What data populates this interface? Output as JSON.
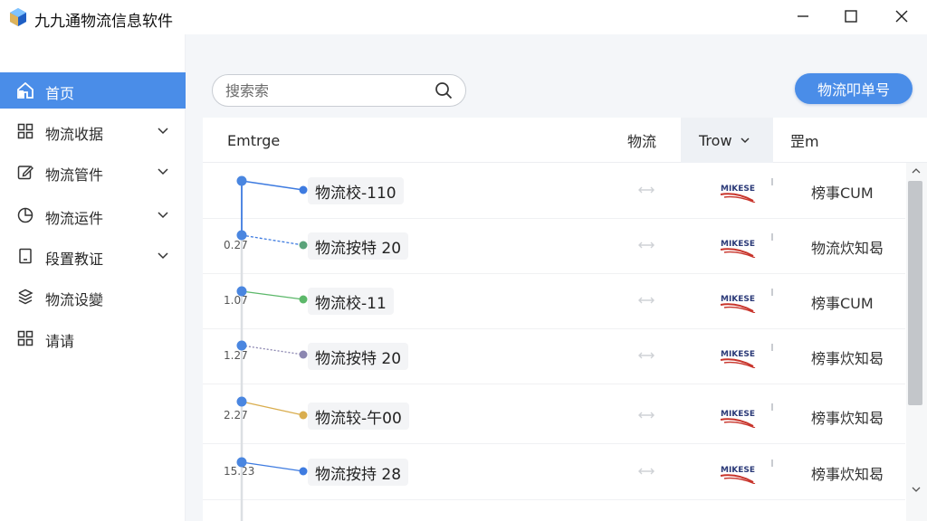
{
  "window": {
    "title": "九九通物流信息软件"
  },
  "sidebar": {
    "items": [
      {
        "label": "首页",
        "icon": "home-icon",
        "active": true,
        "chevron": false
      },
      {
        "label": "物流收据",
        "icon": "grid-icon",
        "active": false,
        "chevron": true
      },
      {
        "label": "物流管件",
        "icon": "edit-icon",
        "active": false,
        "chevron": true
      },
      {
        "label": "物流运件",
        "icon": "pie-chart-icon",
        "active": false,
        "chevron": true
      },
      {
        "label": "段置教证",
        "icon": "document-icon",
        "active": false,
        "chevron": true
      },
      {
        "label": "物流设變",
        "icon": "layers-icon",
        "active": false,
        "chevron": false
      },
      {
        "label": "请请",
        "icon": "grid-icon",
        "active": false,
        "chevron": false
      }
    ]
  },
  "toolbar": {
    "search_placeholder": "搜索索",
    "primary_button": "物流叩单号"
  },
  "table": {
    "columns": [
      {
        "label": "Emtrge"
      },
      {
        "label": "物流"
      },
      {
        "label": "Trow",
        "sorted": true,
        "chevron": "chevron-down-icon"
      },
      {
        "label": "罡m"
      }
    ],
    "rows": [
      {
        "time": "",
        "name": "物流校-110",
        "dot_color": "#3e7be0",
        "brand": "MIKESE",
        "status": "榜事CUM"
      },
      {
        "time": "0.27",
        "name": "物流按特 20",
        "dot_color": "#5aa37a",
        "brand": "MIKESE",
        "status": "物流炊知曷"
      },
      {
        "time": "1.07",
        "name": "物流校-11",
        "dot_color": "#5cb86a",
        "brand": "MIKESE",
        "status": "榜事CUM"
      },
      {
        "time": "1.27",
        "name": "物流按特 20",
        "dot_color": "#8b86b0",
        "brand": "MIKESE",
        "status": "榜事炊知曷"
      },
      {
        "time": "2.27",
        "name": "物流较-午00",
        "dot_color": "#d9ad4e",
        "brand": "MIKESE",
        "status": "榜事炊知曷"
      },
      {
        "time": "15.23",
        "name": "物流按持 28",
        "dot_color": "#3e7be0",
        "brand": "MIKESE",
        "status": "榜事炊知曷"
      }
    ]
  },
  "colors": {
    "accent": "#4a8de8",
    "timeline_node": "#4a86e0",
    "brand_red": "#c8342b",
    "brand_navy": "#2b3a78"
  }
}
